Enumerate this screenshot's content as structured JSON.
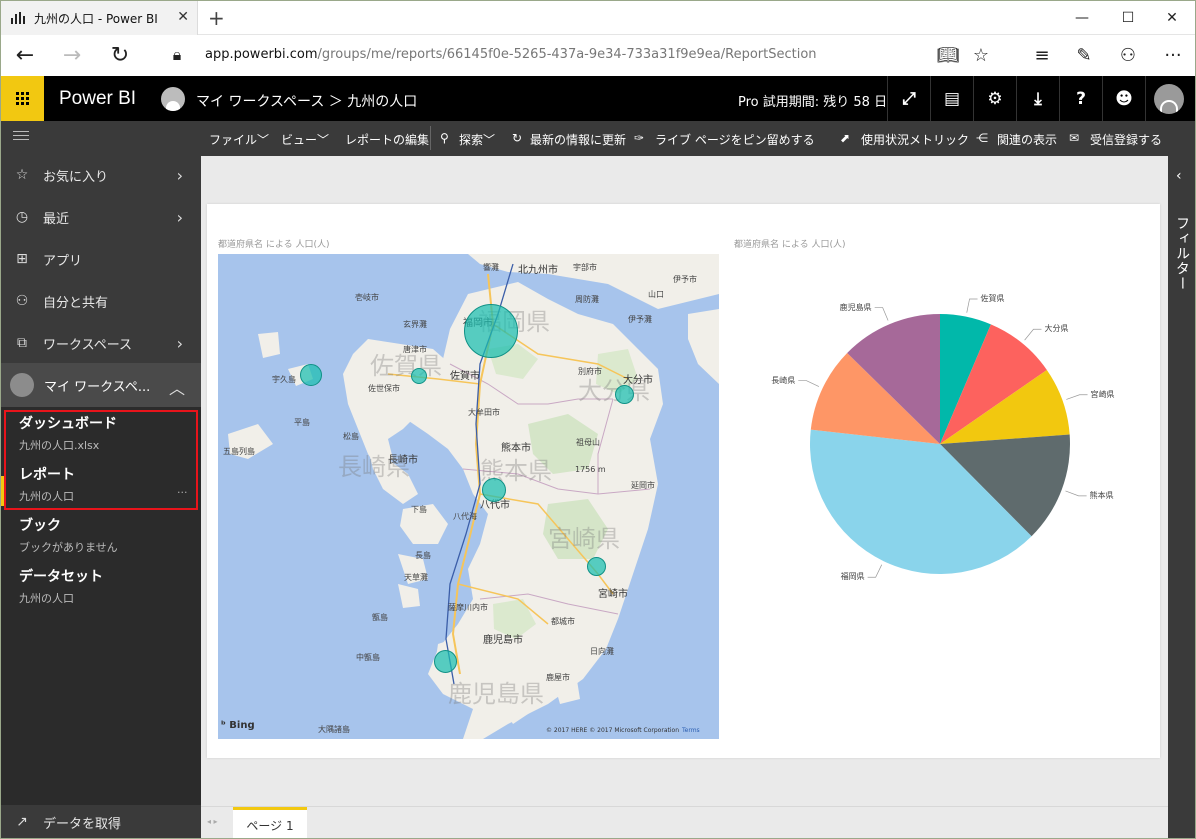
{
  "browser": {
    "tab_title": "九州の人口 - Power BI",
    "url_host": "app.powerbi.com",
    "url_path": "/groups/me/reports/66145f0e-5265-437a-9e34-733a31f9e9ea/ReportSection"
  },
  "header": {
    "app_name": "Power BI",
    "breadcrumb": "マイ ワークスペース ＞ 九州の人口",
    "trial": "Pro 試用期間: 残り 58 日"
  },
  "sidebar": {
    "items": [
      {
        "label": "お気に入り",
        "icon": "star-icon"
      },
      {
        "label": "最近",
        "icon": "clock-icon"
      },
      {
        "label": "アプリ",
        "icon": "apps-icon"
      },
      {
        "label": "自分と共有",
        "icon": "shared-icon"
      },
      {
        "label": "ワークスペース",
        "icon": "workspaces-icon"
      }
    ],
    "workspace_label": "マイ ワークスペ...",
    "sections": [
      {
        "heading": "ダッシュボード",
        "sub": "九州の人口.xlsx"
      },
      {
        "heading": "レポート",
        "sub": "九州の人口"
      },
      {
        "heading": "ブック",
        "sub": "ブックがありません"
      },
      {
        "heading": "データセット",
        "sub": "九州の人口"
      }
    ],
    "more": "···",
    "get_data": "データを取得"
  },
  "toolbar": {
    "file": "ファイル﹀",
    "view": "ビュー﹀",
    "edit": "レポートの編集",
    "explore": "探索﹀",
    "refresh": "最新の情報に更新",
    "pin": "ライブ ページをピン留めする",
    "metrics": "使用状況メトリック",
    "related": "関連の表示",
    "subscribe": "受信登録する"
  },
  "filters_label": "フィルター",
  "page_tab": "ページ 1",
  "map": {
    "title": "都道府県名 による 人口(人)",
    "bing": "Bing",
    "copyright": "© 2017 HERE © 2017 Microsoft Corporation",
    "terms": "Terms",
    "labels": [
      {
        "t": "北九州市",
        "c": ""
      },
      {
        "t": "福岡市",
        "c": ""
      },
      {
        "t": "佐賀市",
        "c": ""
      },
      {
        "t": "大分市",
        "c": ""
      },
      {
        "t": "長崎市",
        "c": ""
      },
      {
        "t": "熊本市",
        "c": ""
      },
      {
        "t": "宮崎市",
        "c": ""
      },
      {
        "t": "鹿児島市",
        "c": ""
      },
      {
        "t": "八代市",
        "c": ""
      },
      {
        "t": "別府市",
        "c": "sm"
      },
      {
        "t": "唐津市",
        "c": "sm"
      },
      {
        "t": "佐世保市",
        "c": "sm"
      },
      {
        "t": "大牟田市",
        "c": "sm"
      },
      {
        "t": "延岡市",
        "c": "sm"
      },
      {
        "t": "都城市",
        "c": "sm"
      },
      {
        "t": "薩摩川内市",
        "c": "sm"
      },
      {
        "t": "鹿屋市",
        "c": "sm"
      },
      {
        "t": "祖母山",
        "c": "sm"
      },
      {
        "t": "1756 m",
        "c": "sm"
      },
      {
        "t": "伊予灘",
        "c": "sm"
      },
      {
        "t": "周防灘",
        "c": "sm"
      },
      {
        "t": "響灘",
        "c": "sm"
      },
      {
        "t": "玄界灘",
        "c": "sm"
      },
      {
        "t": "壱岐市",
        "c": "sm"
      },
      {
        "t": "宇久島",
        "c": "sm"
      },
      {
        "t": "平島",
        "c": "sm"
      },
      {
        "t": "松島",
        "c": "sm"
      },
      {
        "t": "五島列島",
        "c": "sm"
      },
      {
        "t": "日向灘",
        "c": "sm"
      },
      {
        "t": "天草灘",
        "c": "sm"
      },
      {
        "t": "長島",
        "c": "sm"
      },
      {
        "t": "下島",
        "c": "sm"
      },
      {
        "t": "大隅諸島",
        "c": "sm"
      },
      {
        "t": "甑島",
        "c": "sm"
      },
      {
        "t": "八代海",
        "c": "sm"
      },
      {
        "t": "中甑島",
        "c": "sm"
      },
      {
        "t": "宇部市",
        "c": "sm"
      },
      {
        "t": "山口",
        "c": "sm"
      },
      {
        "t": "伊予市",
        "c": "sm"
      },
      {
        "t": "福岡県",
        "c": "big"
      },
      {
        "t": "佐賀県",
        "c": "big"
      },
      {
        "t": "大分県",
        "c": "big"
      },
      {
        "t": "長崎県",
        "c": "big"
      },
      {
        "t": "熊本県",
        "c": "big"
      },
      {
        "t": "宮崎県",
        "c": "big"
      },
      {
        "t": "鹿児島県",
        "c": "big"
      }
    ]
  },
  "chart_data": {
    "type": "pie",
    "title": "都道府県名 による 人口(人)",
    "categories": [
      "佐賀県",
      "大分県",
      "宮崎県",
      "熊本県",
      "福岡県",
      "長崎県",
      "鹿児島県"
    ],
    "values": [
      833,
      1166,
      1104,
      1786,
      5102,
      1377,
      1648
    ],
    "colors": [
      "#01b8aa",
      "#fd625e",
      "#f2c80f",
      "#5f6b6d",
      "#8ad4eb",
      "#fe9666",
      "#a66999"
    ]
  }
}
